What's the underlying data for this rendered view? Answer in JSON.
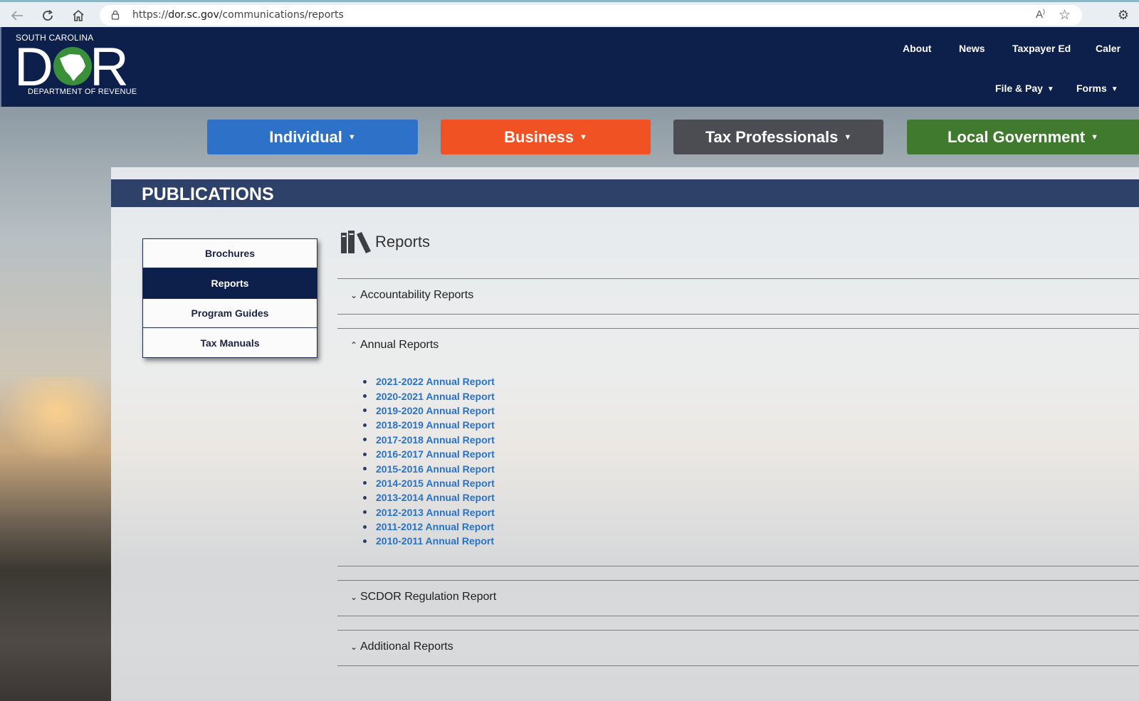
{
  "browser": {
    "url_prefix": "https://",
    "url_host": "dor.sc.gov",
    "url_path": "/communications/reports"
  },
  "logo": {
    "top_text": "SOUTH CAROLINA",
    "letters": "DOR",
    "bottom_text": "DEPARTMENT OF REVENUE"
  },
  "topnav": {
    "about": "About",
    "news": "News",
    "taxpayer_ed": "Taxpayer Ed",
    "calendar_partial": "Caler"
  },
  "subnav": {
    "file_pay": "File & Pay",
    "forms": "Forms"
  },
  "audience": [
    {
      "label": "Individual",
      "color": "#2d72c8"
    },
    {
      "label": "Business",
      "color": "#f05223"
    },
    {
      "label": "Tax Professionals",
      "color": "#4b4d52"
    },
    {
      "label": "Local Government",
      "color": "#3f7a2e"
    }
  ],
  "section_title": "PUBLICATIONS",
  "sidemenu": {
    "items": [
      "Brochures",
      "Reports",
      "Program Guides",
      "Tax Manuals"
    ],
    "active": "Reports"
  },
  "main": {
    "heading": "Reports",
    "accordions": {
      "accountability": "Accountability Reports",
      "annual": "Annual Reports",
      "regulation": "SCDOR Regulation Report",
      "additional": "Additional Reports"
    },
    "annual_reports": [
      "2021-2022 Annual Report",
      "2020-2021 Annual Report",
      "2019-2020 Annual Report",
      "2018-2019 Annual Report",
      "2017-2018 Annual Report",
      "2016-2017 Annual Report",
      "2015-2016 Annual Report",
      "2014-2015 Annual Report",
      "2013-2014 Annual Report",
      "2012-2013 Annual Report",
      "2011-2012 Annual Report",
      "2010-2011 Annual Report"
    ]
  },
  "colors": {
    "header_navy": "#0d1f4b",
    "title_bar": "#2d4169",
    "link_blue": "#2a72c4"
  }
}
